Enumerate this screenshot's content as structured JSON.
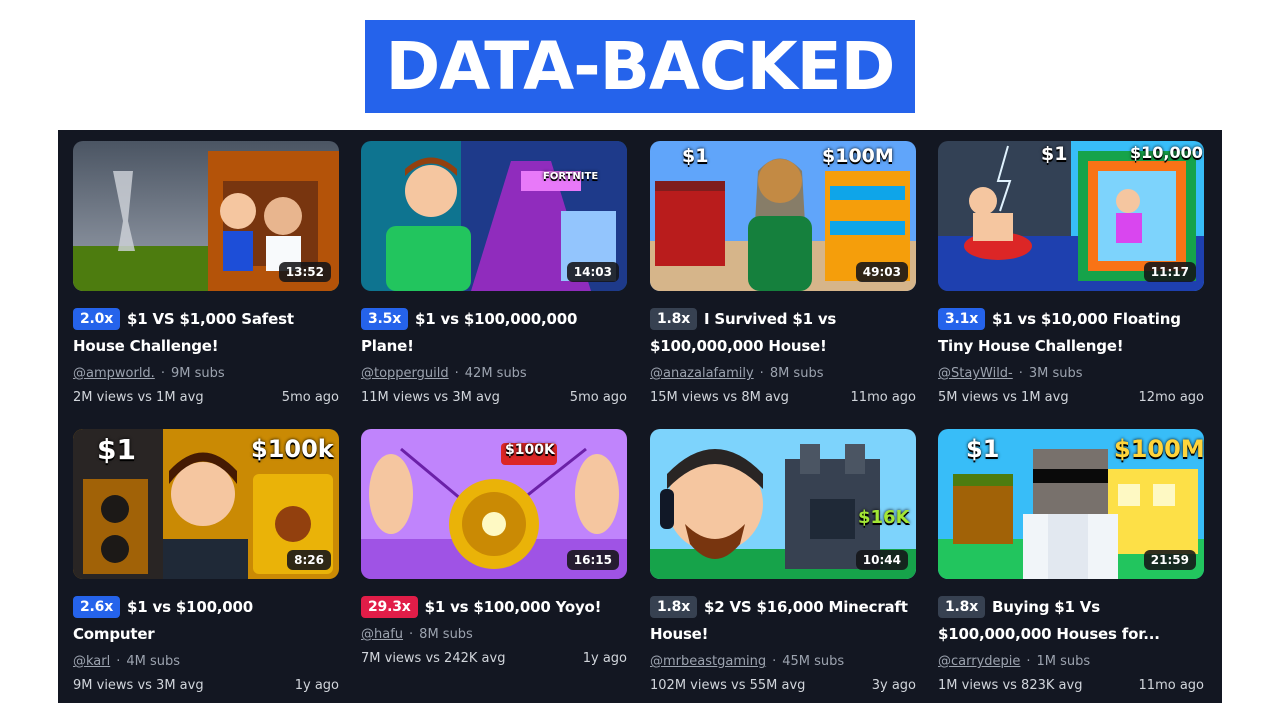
{
  "header": {
    "title": "DATA-BACKED"
  },
  "videos": [
    {
      "badge": "2.0x",
      "badge_color": "#2563eb",
      "title": "$1 VS $1,000 Safest House Challenge!",
      "channel": "@ampworld.",
      "subs": "9M subs",
      "views": "2M views vs 1M avg",
      "age": "5mo ago",
      "duration": "13:52",
      "tags": []
    },
    {
      "badge": "3.5x",
      "badge_color": "#2563eb",
      "title": "$1 vs $100,000,000 Plane!",
      "channel": "@topperguild",
      "subs": "42M subs",
      "views": "11M views vs 3M avg",
      "age": "5mo ago",
      "duration": "14:03",
      "tags": [
        "FORTNITE"
      ]
    },
    {
      "badge": "1.8x",
      "badge_color": "#374151",
      "title": "I Survived $1 vs $100,000,000 House!",
      "channel": "@anazalafamily",
      "subs": "8M subs",
      "views": "15M views vs 8M avg",
      "age": "11mo ago",
      "duration": "49:03",
      "tags": [
        "$1",
        "$100M"
      ]
    },
    {
      "badge": "3.1x",
      "badge_color": "#2563eb",
      "title": "$1 vs $10,000 Floating Tiny House Challenge!",
      "channel": "@StayWild-",
      "subs": "3M subs",
      "views": "5M views vs 1M avg",
      "age": "12mo ago",
      "duration": "11:17",
      "tags": [
        "$1",
        "$10,000"
      ]
    },
    {
      "badge": "2.6x",
      "badge_color": "#2563eb",
      "title": "$1 vs $100,000 Computer",
      "channel": "@karl",
      "subs": "4M subs",
      "views": "9M views vs 3M avg",
      "age": "1y ago",
      "duration": "8:26",
      "tags": [
        "$1",
        "$100k"
      ]
    },
    {
      "badge": "29.3x",
      "badge_color": "#e11d48",
      "title": "$1 vs $100,000 Yoyo!",
      "channel": "@hafu",
      "subs": "8M subs",
      "views": "7M views vs 242K avg",
      "age": "1y ago",
      "duration": "16:15",
      "tags": [
        "$100K"
      ]
    },
    {
      "badge": "1.8x",
      "badge_color": "#374151",
      "title": "$2 VS $16,000 Minecraft House!",
      "channel": "@mrbeastgaming",
      "subs": "45M subs",
      "views": "102M views vs 55M avg",
      "age": "3y ago",
      "duration": "10:44",
      "tags": [
        "$16K"
      ]
    },
    {
      "badge": "1.8x",
      "badge_color": "#374151",
      "title": "Buying $1 Vs $100,000,000 Houses for...",
      "channel": "@carrydepie",
      "subs": "1M subs",
      "views": "1M views vs 823K avg",
      "age": "11mo ago",
      "duration": "21:59",
      "tags": [
        "$1",
        "$100M"
      ]
    }
  ]
}
